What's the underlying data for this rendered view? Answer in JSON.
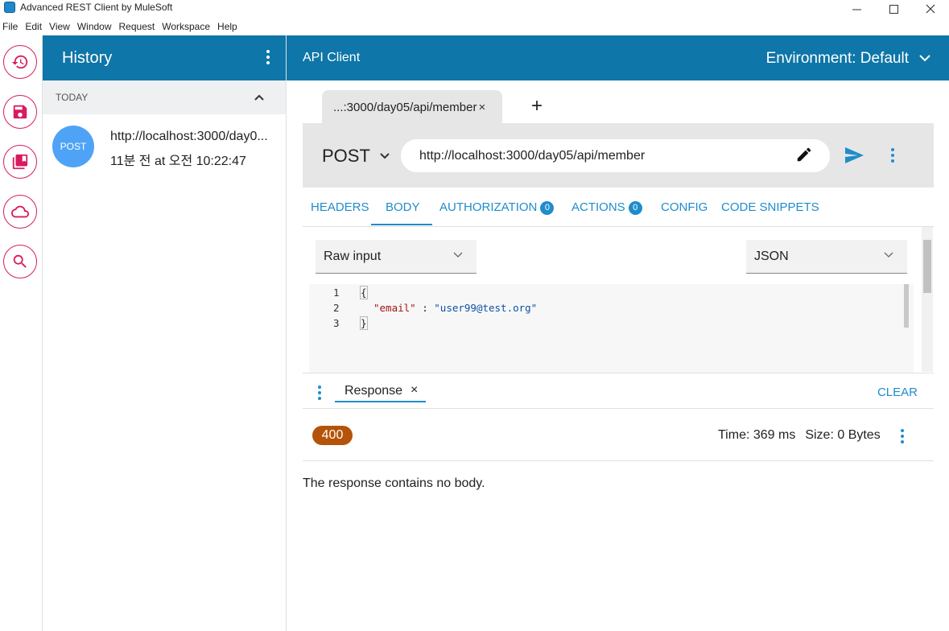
{
  "window": {
    "title": "Advanced REST Client by MuleSoft",
    "minimize": "—",
    "maximize": "☐",
    "close": "✕"
  },
  "menu": [
    "File",
    "Edit",
    "View",
    "Window",
    "Request",
    "Workspace",
    "Help"
  ],
  "rail": {
    "icons": [
      "history-icon",
      "save-icon",
      "library-icon",
      "cloud-icon",
      "search-icon"
    ],
    "accent": "#d81b60"
  },
  "history": {
    "title": "History",
    "group_label": "TODAY",
    "items": [
      {
        "method": "POST",
        "url": "http://localhost:3000/day0...",
        "time": "11분 전 at 오전 10:22:47"
      }
    ]
  },
  "main": {
    "title": "API Client",
    "environment": "Environment: Default",
    "header_color": "#0e76a8"
  },
  "request": {
    "tab_label": "...:3000/day05/api/member",
    "tab_close": "×",
    "add_tab": "+",
    "method": "POST",
    "url": "http://localhost:3000/day05/api/member",
    "tabs": [
      {
        "label": "HEADERS"
      },
      {
        "label": "BODY",
        "active": true
      },
      {
        "label": "AUTHORIZATION",
        "count": "0"
      },
      {
        "label": "ACTIONS",
        "count": "0"
      },
      {
        "label": "CONFIG"
      },
      {
        "label": "CODE SNIPPETS"
      }
    ],
    "body_editor": "Raw input",
    "content_type": "JSON",
    "code": {
      "line_numbers": [
        "1",
        "2",
        "3"
      ],
      "open": "{",
      "key": "\"email\"",
      "sep": " : ",
      "value": "\"user99@test.org\"",
      "close": "}"
    }
  },
  "response": {
    "tab_label": "Response",
    "tab_close": "×",
    "clear": "CLEAR",
    "status": "400",
    "status_color": "#b45309",
    "time": "Time: 369 ms",
    "size": "Size: 0 Bytes",
    "message": "The response contains no body."
  }
}
